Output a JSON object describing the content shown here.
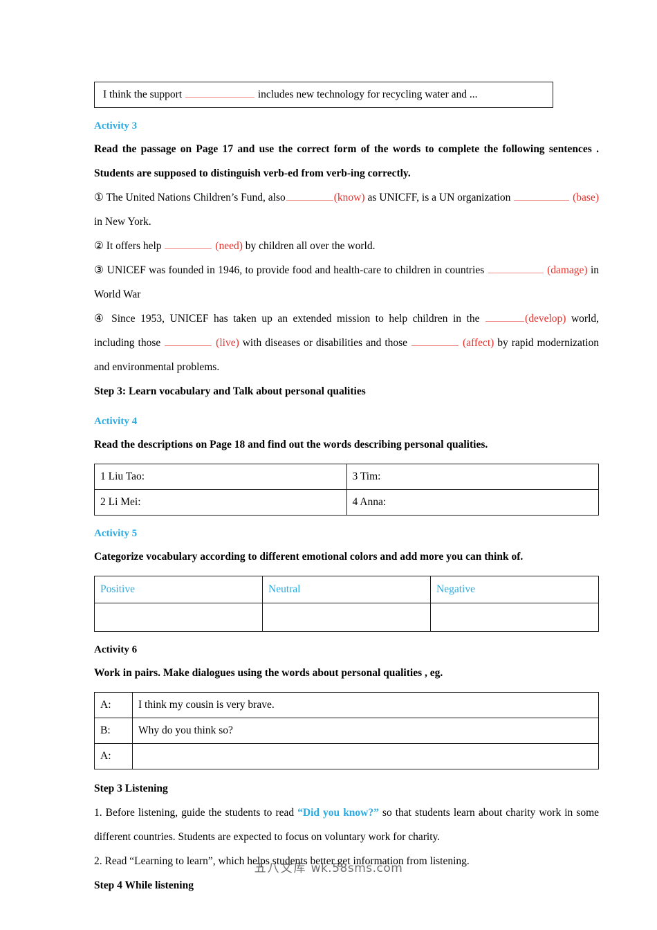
{
  "document": {
    "type": "lesson-plan-worksheet",
    "accent_color": "#29abe2",
    "red_color": "#e8302a",
    "blank_line_color": "#ef8b86"
  },
  "top_box": {
    "text_before": "I think the support",
    "text_after": "includes new technology for recycling water and ..."
  },
  "activity3": {
    "heading": "Activity 3",
    "instruction": "Read the passage on Page 17 and use the correct form of the words to complete the following sentences . Students are supposed to distinguish verb-ed from verb-ing correctly.",
    "items": [
      {
        "marker": "①",
        "part1": "The United Nations Children’s Fund, also",
        "cue1": "(know)",
        "part2": "as UNICFF, is a UN organization",
        "cue2": "(base)",
        "part3": "in New York."
      },
      {
        "marker": "②",
        "part1": "It offers help",
        "cue1": "(need)",
        "part2": "by children all over the world."
      },
      {
        "marker": "③",
        "part1": "UNICEF was founded in 1946, to provide food and health-care to children in countries",
        "cue1": "(damage)",
        "part2": "in World War"
      },
      {
        "marker": "④",
        "part1": "Since 1953, UNICEF has taken up an extended mission to help children in the",
        "cue1": "(develop)",
        "part2": "world, including those",
        "cue2": "(live)",
        "part3": "with diseases or disabilities and those",
        "cue3": "(affect)",
        "part4": "by rapid modernization and environmental problems."
      }
    ]
  },
  "step3_vocab": {
    "heading": "Step 3: Learn vocabulary and Talk about personal qualities"
  },
  "activity4": {
    "heading": "Activity 4",
    "instruction": "Read the descriptions on Page 18 and find out the words describing personal qualities.",
    "table": {
      "rows": [
        [
          "1  Liu Tao:",
          "3  Tim:"
        ],
        [
          "2  Li Mei:",
          "4  Anna:"
        ]
      ]
    }
  },
  "activity5": {
    "heading": "Activity 5",
    "instruction": "Categorize vocabulary according to different emotional colors and add more you can think of.",
    "table": {
      "headers": [
        "Positive",
        "Neutral",
        "Negative"
      ],
      "rows": [
        [
          "",
          "",
          ""
        ]
      ]
    }
  },
  "activity6": {
    "heading": "Activity 6",
    "instruction": "Work in pairs. Make dialogues using the words about personal qualities , eg.",
    "dialogue": [
      {
        "speaker": "A:",
        "line": "I think my cousin is very brave."
      },
      {
        "speaker": "B:",
        "line": "Why do you think so?"
      },
      {
        "speaker": "A:",
        "line": ""
      }
    ]
  },
  "step3_listening": {
    "heading": "Step 3  Listening",
    "item1_part1": "1. Before listening, guide the students to read",
    "item1_quote": "“Did you know?”",
    "item1_part2": "so that students learn about charity work in some different countries. Students are expected to focus on voluntary work for charity.",
    "item2": "2. Read “Learning to learn”, which helps students better get information from listening."
  },
  "step4": {
    "heading": "Step 4  While listening"
  },
  "watermark": {
    "cn": "五八文库",
    "en": "wk.58sms.com"
  }
}
